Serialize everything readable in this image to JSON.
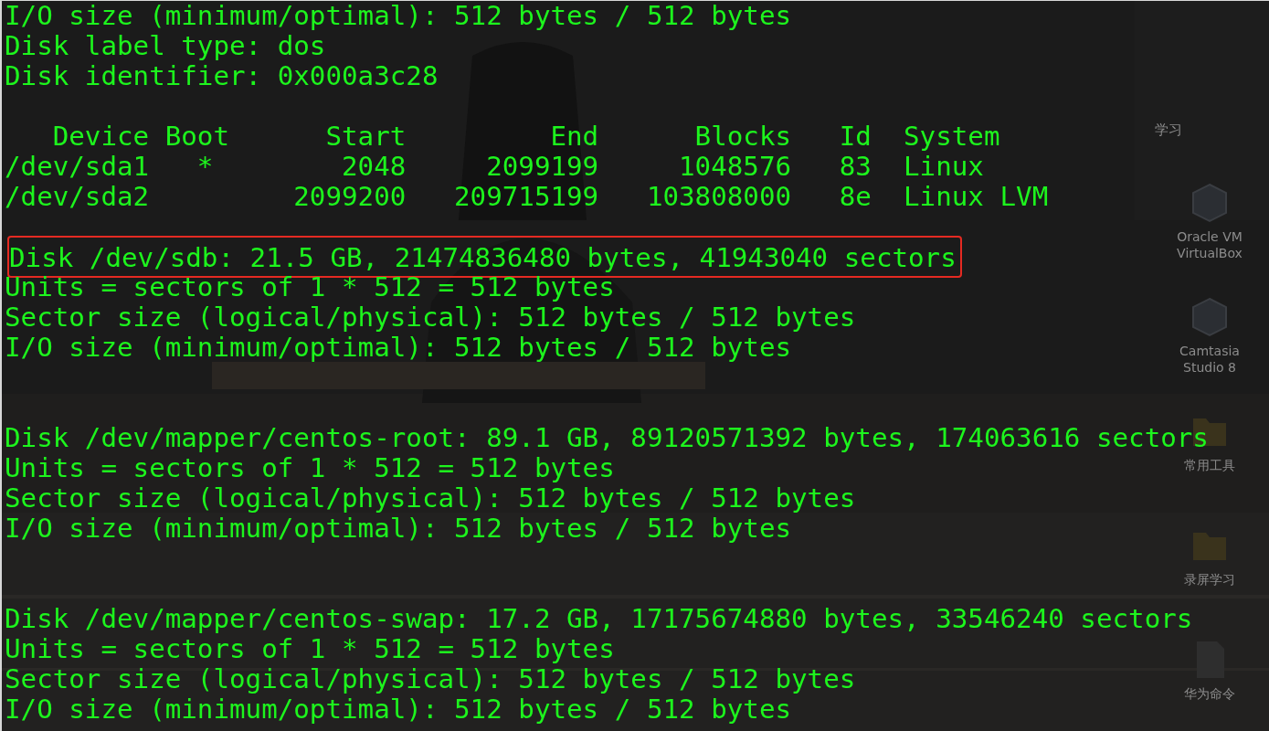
{
  "desktop": {
    "group_label": "学习",
    "icons": [
      {
        "label": "Oracle VM VirtualBox",
        "kind": "app"
      },
      {
        "label": "Camtasia Studio 8",
        "kind": "app"
      },
      {
        "label": "常用工具",
        "kind": "folder"
      },
      {
        "label": "录屏学习",
        "kind": "folder"
      },
      {
        "label": "华为命令",
        "kind": "document"
      }
    ]
  },
  "terminal": {
    "lines": [
      {
        "kind": "text",
        "text": "I/O size (minimum/optimal): 512 bytes / 512 bytes"
      },
      {
        "kind": "text",
        "text": "Disk label type: dos"
      },
      {
        "kind": "text",
        "text": "Disk identifier: 0x000a3c28"
      },
      {
        "kind": "blank"
      },
      {
        "kind": "text",
        "text": "   Device Boot      Start         End      Blocks   Id  System"
      },
      {
        "kind": "text",
        "text": "/dev/sda1   *        2048     2099199     1048576   83  Linux"
      },
      {
        "kind": "text",
        "text": "/dev/sda2         2099200   209715199   103808000   8e  Linux LVM"
      },
      {
        "kind": "blank"
      },
      {
        "kind": "boxed",
        "text": "Disk /dev/sdb: 21.5 GB, 21474836480 bytes, 41943040 sectors"
      },
      {
        "kind": "text",
        "text": "Units = sectors of 1 * 512 = 512 bytes"
      },
      {
        "kind": "text",
        "text": "Sector size (logical/physical): 512 bytes / 512 bytes"
      },
      {
        "kind": "text",
        "text": "I/O size (minimum/optimal): 512 bytes / 512 bytes"
      },
      {
        "kind": "blank"
      },
      {
        "kind": "blank"
      },
      {
        "kind": "text",
        "text": "Disk /dev/mapper/centos-root: 89.1 GB, 89120571392 bytes, 174063616 sectors"
      },
      {
        "kind": "text",
        "text": "Units = sectors of 1 * 512 = 512 bytes"
      },
      {
        "kind": "text",
        "text": "Sector size (logical/physical): 512 bytes / 512 bytes"
      },
      {
        "kind": "text",
        "text": "I/O size (minimum/optimal): 512 bytes / 512 bytes"
      },
      {
        "kind": "blank"
      },
      {
        "kind": "blank"
      },
      {
        "kind": "text",
        "text": "Disk /dev/mapper/centos-swap: 17.2 GB, 17175674880 bytes, 33546240 sectors"
      },
      {
        "kind": "text",
        "text": "Units = sectors of 1 * 512 = 512 bytes"
      },
      {
        "kind": "text",
        "text": "Sector size (logical/physical): 512 bytes / 512 bytes"
      },
      {
        "kind": "text",
        "text": "I/O size (minimum/optimal): 512 bytes / 512 bytes"
      }
    ]
  }
}
